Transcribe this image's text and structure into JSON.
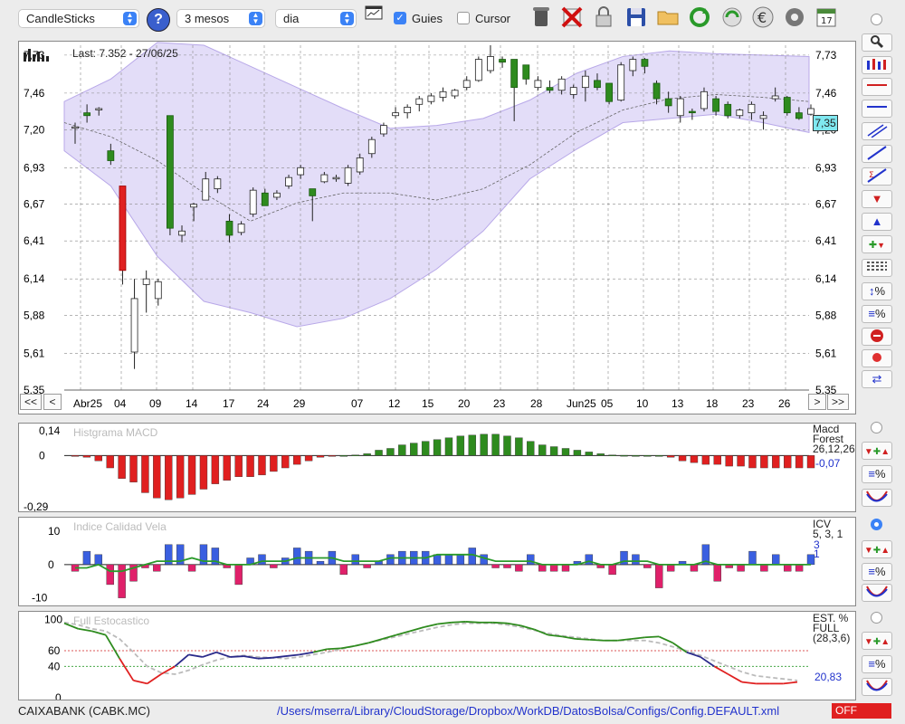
{
  "toolbar": {
    "chart_type": "CandleSticks",
    "period": "3 mesos",
    "interval": "dia",
    "guides_label": "Guies",
    "guides_checked": true,
    "cursor_label": "Cursor",
    "cursor_checked": false,
    "help_label": "?",
    "calendar_day": "17",
    "icons": [
      "trash-icon",
      "delete-icon",
      "lock-icon",
      "save-icon",
      "open-folder-icon",
      "refresh-icon",
      "sync-icon",
      "euro-icon",
      "settings-icon",
      "calendar-icon"
    ]
  },
  "main_chart": {
    "last_label": "Last: 7.352 - 27/06/25",
    "price_badge": "7,35",
    "y_ticks": [
      "7,73",
      "7,46",
      "7,20",
      "6,93",
      "6,67",
      "6,41",
      "6,14",
      "5,88",
      "5,61",
      "5,35"
    ],
    "y_range": [
      5.35,
      7.8
    ],
    "x_labels": [
      "Abr25",
      "04",
      "09",
      "14",
      "17",
      "24",
      "29",
      "07",
      "12",
      "15",
      "20",
      "23",
      "28",
      "Jun25",
      "05",
      "10",
      "13",
      "18",
      "23",
      "26"
    ],
    "nav": {
      "first": "<<",
      "prev": "<",
      "next": ">",
      "last": ">>"
    }
  },
  "chart_data": [
    {
      "type": "candlestick",
      "title": "Last: 7.352 - 27/06/25",
      "ylim": [
        5.35,
        7.8
      ],
      "candles": [
        {
          "o": 7.22,
          "h": 7.25,
          "l": 7.1,
          "c": 7.22
        },
        {
          "o": 7.32,
          "h": 7.38,
          "l": 7.25,
          "c": 7.3
        },
        {
          "o": 7.34,
          "h": 7.36,
          "l": 7.3,
          "c": 7.35
        },
        {
          "o": 7.05,
          "h": 7.1,
          "l": 6.95,
          "c": 6.98
        },
        {
          "o": 6.8,
          "h": 6.8,
          "l": 6.1,
          "c": 6.2
        },
        {
          "o": 5.62,
          "h": 6.14,
          "l": 5.5,
          "c": 6.0
        },
        {
          "o": 6.1,
          "h": 6.2,
          "l": 5.9,
          "c": 6.14
        },
        {
          "o": 6.0,
          "h": 6.14,
          "l": 5.95,
          "c": 6.12
        },
        {
          "o": 7.3,
          "h": 7.3,
          "l": 6.45,
          "c": 6.5
        },
        {
          "o": 6.45,
          "h": 6.52,
          "l": 6.4,
          "c": 6.48
        },
        {
          "o": 6.65,
          "h": 6.68,
          "l": 6.55,
          "c": 6.67
        },
        {
          "o": 6.7,
          "h": 6.9,
          "l": 6.7,
          "c": 6.85
        },
        {
          "o": 6.78,
          "h": 6.87,
          "l": 6.75,
          "c": 6.85
        },
        {
          "o": 6.55,
          "h": 6.6,
          "l": 6.4,
          "c": 6.45
        },
        {
          "o": 6.47,
          "h": 6.55,
          "l": 6.45,
          "c": 6.53
        },
        {
          "o": 6.6,
          "h": 6.79,
          "l": 6.58,
          "c": 6.77
        },
        {
          "o": 6.75,
          "h": 6.78,
          "l": 6.66,
          "c": 6.66
        },
        {
          "o": 6.72,
          "h": 6.77,
          "l": 6.7,
          "c": 6.75
        },
        {
          "o": 6.8,
          "h": 6.88,
          "l": 6.78,
          "c": 6.86
        },
        {
          "o": 6.88,
          "h": 6.95,
          "l": 6.85,
          "c": 6.93
        },
        {
          "o": 6.78,
          "h": 6.78,
          "l": 6.55,
          "c": 6.73
        },
        {
          "o": 6.83,
          "h": 6.9,
          "l": 6.82,
          "c": 6.88
        },
        {
          "o": 6.85,
          "h": 6.88,
          "l": 6.83,
          "c": 6.86
        },
        {
          "o": 6.82,
          "h": 6.95,
          "l": 6.8,
          "c": 6.93
        },
        {
          "o": 6.9,
          "h": 7.03,
          "l": 6.88,
          "c": 7.0
        },
        {
          "o": 7.03,
          "h": 7.15,
          "l": 7.0,
          "c": 7.13
        },
        {
          "o": 7.17,
          "h": 7.25,
          "l": 7.15,
          "c": 7.23
        },
        {
          "o": 7.3,
          "h": 7.36,
          "l": 7.28,
          "c": 7.32
        },
        {
          "o": 7.32,
          "h": 7.38,
          "l": 7.28,
          "c": 7.36
        },
        {
          "o": 7.38,
          "h": 7.44,
          "l": 7.33,
          "c": 7.42
        },
        {
          "o": 7.4,
          "h": 7.46,
          "l": 7.38,
          "c": 7.44
        },
        {
          "o": 7.43,
          "h": 7.5,
          "l": 7.4,
          "c": 7.47
        },
        {
          "o": 7.44,
          "h": 7.49,
          "l": 7.42,
          "c": 7.48
        },
        {
          "o": 7.5,
          "h": 7.58,
          "l": 7.48,
          "c": 7.55
        },
        {
          "o": 7.55,
          "h": 7.72,
          "l": 7.54,
          "c": 7.7
        },
        {
          "o": 7.62,
          "h": 7.8,
          "l": 7.6,
          "c": 7.72
        },
        {
          "o": 7.7,
          "h": 7.72,
          "l": 7.64,
          "c": 7.68
        },
        {
          "o": 7.7,
          "h": 7.7,
          "l": 7.26,
          "c": 7.5
        },
        {
          "o": 7.66,
          "h": 7.66,
          "l": 7.52,
          "c": 7.56
        },
        {
          "o": 7.5,
          "h": 7.58,
          "l": 7.48,
          "c": 7.55
        },
        {
          "o": 7.5,
          "h": 7.55,
          "l": 7.46,
          "c": 7.48
        },
        {
          "o": 7.48,
          "h": 7.58,
          "l": 7.45,
          "c": 7.56
        },
        {
          "o": 7.45,
          "h": 7.52,
          "l": 7.42,
          "c": 7.5
        },
        {
          "o": 7.5,
          "h": 7.62,
          "l": 7.4,
          "c": 7.58
        },
        {
          "o": 7.55,
          "h": 7.6,
          "l": 7.48,
          "c": 7.5
        },
        {
          "o": 7.53,
          "h": 7.53,
          "l": 7.38,
          "c": 7.4
        },
        {
          "o": 7.41,
          "h": 7.68,
          "l": 7.4,
          "c": 7.66
        },
        {
          "o": 7.62,
          "h": 7.72,
          "l": 7.58,
          "c": 7.7
        },
        {
          "o": 7.7,
          "h": 7.71,
          "l": 7.6,
          "c": 7.65
        },
        {
          "o": 7.53,
          "h": 7.55,
          "l": 7.38,
          "c": 7.42
        },
        {
          "o": 7.42,
          "h": 7.47,
          "l": 7.32,
          "c": 7.37
        },
        {
          "o": 7.3,
          "h": 7.44,
          "l": 7.25,
          "c": 7.42
        },
        {
          "o": 7.33,
          "h": 7.35,
          "l": 7.27,
          "c": 7.32
        },
        {
          "o": 7.35,
          "h": 7.5,
          "l": 7.33,
          "c": 7.47
        },
        {
          "o": 7.42,
          "h": 7.44,
          "l": 7.3,
          "c": 7.33
        },
        {
          "o": 7.38,
          "h": 7.4,
          "l": 7.28,
          "c": 7.3
        },
        {
          "o": 7.3,
          "h": 7.35,
          "l": 7.28,
          "c": 7.34
        },
        {
          "o": 7.32,
          "h": 7.4,
          "l": 7.27,
          "c": 7.38
        },
        {
          "o": 7.28,
          "h": 7.33,
          "l": 7.2,
          "c": 7.3
        },
        {
          "o": 7.42,
          "h": 7.5,
          "l": 7.4,
          "c": 7.44
        },
        {
          "o": 7.43,
          "h": 7.44,
          "l": 7.3,
          "c": 7.32
        },
        {
          "o": 7.32,
          "h": 7.36,
          "l": 7.27,
          "c": 7.28
        },
        {
          "o": 7.31,
          "h": 7.38,
          "l": 7.3,
          "c": 7.35
        }
      ],
      "bollinger": {
        "upper": [
          7.4,
          7.56,
          7.82,
          7.8,
          7.65,
          7.5,
          7.35,
          7.21,
          7.23,
          7.28,
          7.41,
          7.6,
          7.72,
          7.76,
          7.74,
          7.73,
          7.72
        ],
        "middle": [
          7.25,
          7.15,
          6.98,
          6.75,
          6.55,
          6.68,
          6.75,
          6.75,
          6.7,
          6.78,
          6.95,
          7.18,
          7.34,
          7.42,
          7.45,
          7.43,
          7.4
        ],
        "lower": [
          7.05,
          6.8,
          6.3,
          5.98,
          5.9,
          5.8,
          5.86,
          6.0,
          6.21,
          6.48,
          6.85,
          7.06,
          7.25,
          7.28,
          7.31,
          7.25,
          7.18
        ]
      }
    },
    {
      "type": "bar",
      "title": "Histgrama MACD",
      "legend": [
        "Macd",
        "Forest",
        "26,12,26"
      ],
      "last_value": "-0,07",
      "y_ticks": [
        "0,14",
        "0",
        "-0,29"
      ],
      "ylim": [
        -0.31,
        0.16
      ],
      "values": [
        -0.002,
        -0.01,
        -0.03,
        -0.07,
        -0.13,
        -0.15,
        -0.21,
        -0.24,
        -0.25,
        -0.24,
        -0.22,
        -0.19,
        -0.16,
        -0.14,
        -0.12,
        -0.12,
        -0.11,
        -0.09,
        -0.07,
        -0.05,
        -0.03,
        -0.01,
        -0.005,
        0,
        0.003,
        0.01,
        0.03,
        0.04,
        0.06,
        0.07,
        0.08,
        0.09,
        0.1,
        0.11,
        0.115,
        0.12,
        0.12,
        0.11,
        0.1,
        0.08,
        0.06,
        0.05,
        0.04,
        0.03,
        0.02,
        0.01,
        0.003,
        0.001,
        0,
        0,
        0,
        -0.01,
        -0.03,
        -0.04,
        -0.05,
        -0.05,
        -0.06,
        -0.06,
        -0.07,
        -0.07,
        -0.07,
        -0.07,
        -0.07,
        -0.07
      ]
    },
    {
      "type": "bar",
      "title": "Indice Calidad Vela",
      "legend": [
        "ICV",
        "5, 3, 1"
      ],
      "last_values": [
        "3",
        "1"
      ],
      "y_ticks": [
        "10",
        "0",
        "-10"
      ],
      "ylim": [
        -12,
        13
      ],
      "values": [
        -2,
        4,
        3,
        -6,
        -10,
        -5,
        -1,
        -2,
        6,
        6,
        -2,
        6,
        5,
        -1,
        -6,
        2,
        3,
        -1,
        2,
        5,
        4,
        1,
        4,
        -3,
        3,
        -1,
        1,
        3,
        4,
        4,
        4,
        3,
        3,
        3,
        5,
        3,
        -1,
        -1,
        -2,
        3,
        -2,
        -2,
        -2,
        1,
        3,
        -1,
        -3,
        4,
        3,
        -1,
        -7,
        -2,
        1,
        -2,
        6,
        -5,
        -1,
        -2,
        4,
        -2,
        3,
        -2,
        -2,
        3
      ],
      "line": [
        -1,
        -1,
        0,
        -2,
        -2,
        -1,
        0,
        1,
        1,
        1,
        2,
        1,
        1,
        0,
        0,
        0,
        1,
        1,
        1,
        2,
        2,
        2,
        2,
        1,
        1,
        1,
        1,
        2,
        2,
        2,
        2,
        3,
        3,
        3,
        3,
        2,
        1,
        1,
        1,
        1,
        0,
        0,
        0,
        0,
        1,
        0,
        0,
        1,
        1,
        1,
        0,
        0,
        0,
        0,
        1,
        0,
        0,
        0,
        0,
        0,
        0,
        0,
        0,
        0
      ]
    },
    {
      "type": "line",
      "title": "Full Estocastico",
      "legend": [
        "EST. %",
        "FULL",
        "(28,3,6)"
      ],
      "last_value": "20,83",
      "y_ticks": [
        "100",
        "60",
        "40",
        "0"
      ],
      "ylim": [
        0,
        105
      ],
      "k": [
        95,
        88,
        85,
        80,
        50,
        22,
        18,
        30,
        40,
        55,
        52,
        58,
        52,
        53,
        50,
        51,
        53,
        55,
        58,
        62,
        63,
        66,
        70,
        75,
        80,
        85,
        90,
        94,
        96,
        97,
        96,
        96,
        95,
        92,
        87,
        80,
        78,
        75,
        74,
        73,
        73,
        75,
        77,
        78,
        70,
        58,
        52,
        40,
        30,
        20,
        18,
        18,
        18,
        20
      ],
      "d": [
        96,
        93,
        88,
        85,
        75,
        58,
        40,
        32,
        30,
        35,
        42,
        48,
        52,
        54,
        52,
        51,
        50,
        52,
        55,
        58,
        62,
        66,
        70,
        74,
        78,
        82,
        86,
        90,
        93,
        95,
        95,
        95,
        93,
        90,
        86,
        82,
        79,
        77,
        75,
        73,
        73,
        73,
        73,
        70,
        65,
        60,
        54,
        47,
        40,
        33,
        28,
        26,
        24,
        22
      ]
    }
  ],
  "macd_panel": {
    "title": "Histgrama MACD",
    "legend_1": "Macd",
    "legend_2": "Forest",
    "legend_3": "26,12,26",
    "value": "-0,07",
    "ticks": [
      "0,14",
      "0",
      "-0,29"
    ]
  },
  "icv_panel": {
    "title": "Indice Calidad Vela",
    "legend_1": "ICV",
    "legend_2": "5, 3, 1",
    "value_1": "3",
    "value_2": "1",
    "ticks": [
      "10",
      "0",
      "-10"
    ]
  },
  "stoch_panel": {
    "title": "Full Estocastico",
    "legend_1": "EST. %",
    "legend_2": "FULL",
    "legend_3": "(28,3,6)",
    "value": "20,83",
    "ticks": [
      "100",
      "60",
      "40",
      "0"
    ]
  },
  "footer": {
    "symbol": "CAIXABANK (CABK.MC)",
    "config_path": "/Users/mserra/Library/CloudStorage/Dropbox/WorkDB/DatosBolsa/Configs/Config.DEFAULT.xml",
    "status": "OFF"
  },
  "colors": {
    "up": "#ffffff",
    "down": "#2e8b1e",
    "big_down": "#e02020",
    "macd_pos": "#2e8b1e",
    "macd_neg": "#e02020",
    "icv_pos": "#3a5fe0",
    "icv_neg": "#e0206a",
    "stoch_k_up": "#2e8b1e",
    "stoch_k_mid": "#2a2a8a",
    "stoch_k_low": "#e02020",
    "band": "#d9d2f5"
  }
}
